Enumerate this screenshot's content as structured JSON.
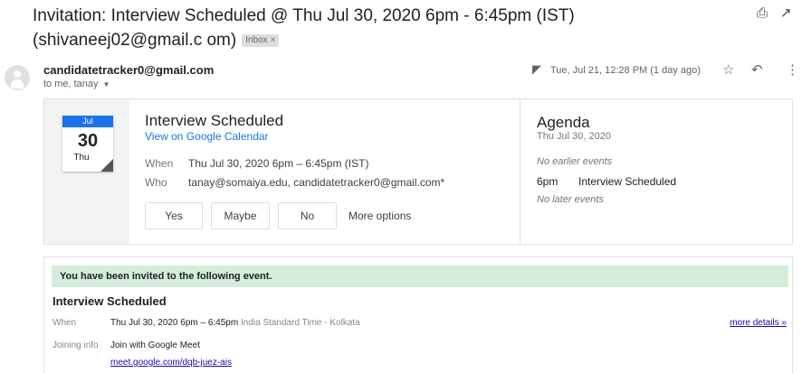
{
  "subject": "Invitation: Interview Scheduled @ Thu Jul 30, 2020 6pm - 6:45pm (IST) (shivaneej02@gmail.c om)",
  "inbox_label": "Inbox ×",
  "icons": {
    "print": "print-icon",
    "open_new": "open-in-new-window-icon",
    "avatar": "default-avatar-icon",
    "attachment": "attachment-icon",
    "star": "star-icon",
    "reply": "reply-icon",
    "more": "more-vertical-icon",
    "dropdown": "chevron-down-icon"
  },
  "sender": "candidatetracker0@gmail.com",
  "recipients": "to me, tanay",
  "date": "Tue, Jul 21, 12:28 PM (1 day ago)",
  "calendar_icon": {
    "month": "Jul",
    "day": "30",
    "weekday": "Thu"
  },
  "event": {
    "title": "Interview Scheduled",
    "view_link": "View on Google Calendar",
    "when_label": "When",
    "when_value": "Thu Jul 30, 2020 6pm – 6:45pm (IST)",
    "who_label": "Who",
    "who_value": "tanay@somaiya.edu, candidatetracker0@gmail.com*"
  },
  "rsvp": {
    "yes": "Yes",
    "maybe": "Maybe",
    "no": "No",
    "more_options": "More options"
  },
  "agenda": {
    "title": "Agenda",
    "date": "Thu Jul 30, 2020",
    "no_earlier": "No earlier events",
    "time": "6pm",
    "event": "Interview Scheduled",
    "no_later": "No later events"
  },
  "invite": {
    "banner": "You have been invited to the following event.",
    "title": "Interview Scheduled",
    "when_label": "When",
    "when_value": "Thu Jul 30, 2020 6pm – 6:45pm",
    "when_tz": "India Standard Time - Kolkata",
    "more_details": "more details »",
    "joining_label": "Joining info",
    "joining_value": "Join with Google Meet",
    "meet_link": "meet.google.com/dqb-juez-ais"
  },
  "colors": {
    "accent": "#1a73e8",
    "banner_bg": "#d4edda",
    "link": "#1a0dab"
  }
}
